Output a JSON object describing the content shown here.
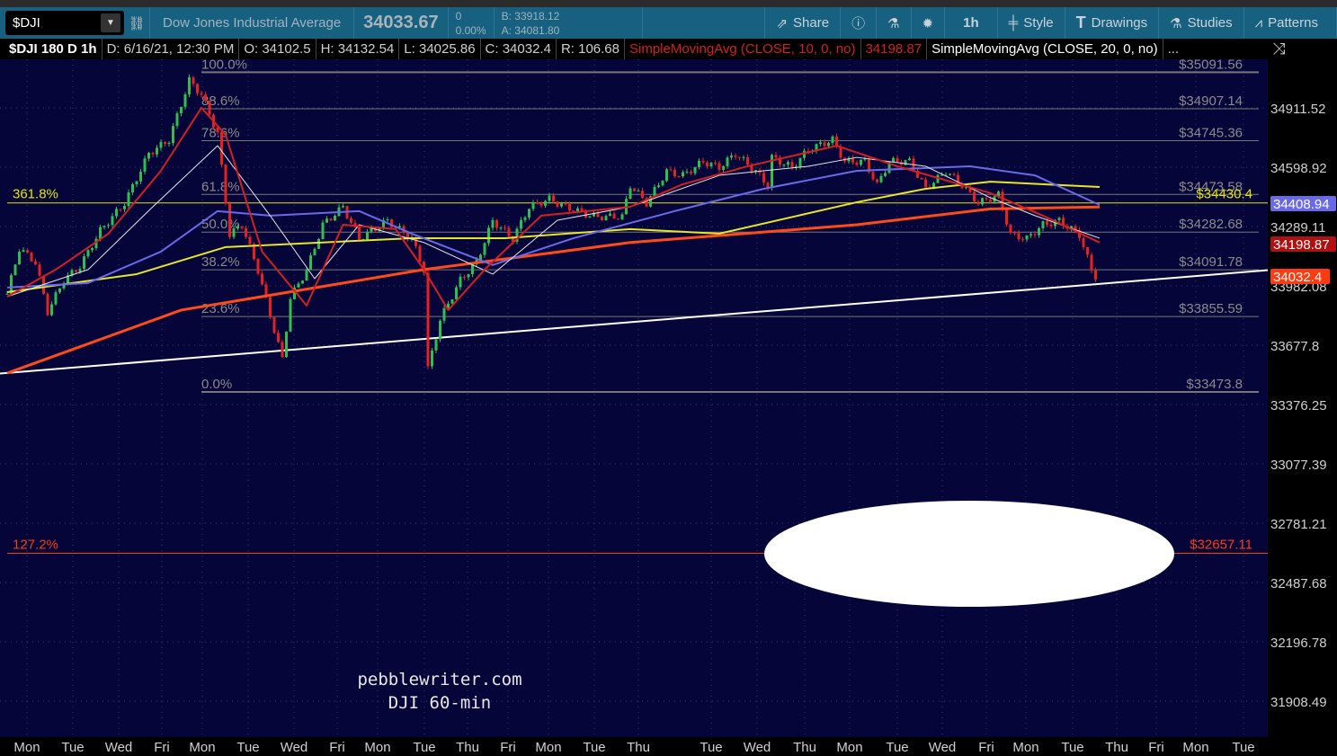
{
  "toolbar": {
    "symbol": "$DJI",
    "name": "Dow Jones Industrial Average",
    "last": "34033.67",
    "change": "0",
    "change_pct": "0.00%",
    "bid": "B: 33918.12",
    "ask": "A: 34081.80",
    "share": "Share",
    "interval": "1h",
    "style": "Style",
    "drawings": "Drawings",
    "studies": "Studies",
    "patterns": "Patterns"
  },
  "infobar": {
    "title": "$DJI 180 D 1h",
    "date": "D: 6/16/21, 12:30 PM",
    "open": "O: 34102.5",
    "high": "H: 34132.54",
    "low": "L: 34025.86",
    "close": "C: 34032.4",
    "range": "R: 106.68",
    "sma10": "SimpleMovingAvg (CLOSE, 10, 0, no)",
    "sma10_value": "34198.87",
    "sma20": "SimpleMovingAvg (CLOSE, 20, 0, no)",
    "more": "..."
  },
  "watermark": {
    "line1": "pebblewriter.com",
    "line2": "DJI  60-min"
  },
  "chart_data": {
    "type": "candlestick",
    "background": "#05053a",
    "y_ticks": [
      "34911.52",
      "34598.92",
      "34289.11",
      "33982.08",
      "33677.8",
      "33376.25",
      "33077.39",
      "32781.21",
      "32487.68",
      "32196.78",
      "31908.49"
    ],
    "x_ticks": [
      "Mon",
      "Tue",
      "Wed",
      "Fri",
      "Mon",
      "Tue",
      "Wed",
      "Fri",
      "Mon",
      "Tue",
      "Thu",
      "Fri",
      "Mon",
      "Tue",
      "Thu",
      "Tue",
      "Wed",
      "Thu",
      "Mon",
      "Tue",
      "Wed",
      "Fri",
      "Mon",
      "Tue",
      "Thu",
      "Fri",
      "Mon",
      "Tue"
    ],
    "closes": [
      [
        0,
        33970
      ],
      [
        3,
        34200
      ],
      [
        7,
        34130
      ],
      [
        10,
        33880
      ],
      [
        14,
        34040
      ],
      [
        18,
        34110
      ],
      [
        23,
        34290
      ],
      [
        29,
        34430
      ],
      [
        35,
        34680
      ],
      [
        40,
        34750
      ],
      [
        45,
        35050
      ],
      [
        48,
        34980
      ],
      [
        52,
        34780
      ],
      [
        55,
        34270
      ],
      [
        58,
        34320
      ],
      [
        62,
        34090
      ],
      [
        65,
        33860
      ],
      [
        68,
        33640
      ],
      [
        70,
        33950
      ],
      [
        74,
        34090
      ],
      [
        78,
        34320
      ],
      [
        83,
        34410
      ],
      [
        87,
        34250
      ],
      [
        94,
        34340
      ],
      [
        100,
        34250
      ],
      [
        103,
        34090
      ],
      [
        104,
        33590
      ],
      [
        107,
        33840
      ],
      [
        112,
        34040
      ],
      [
        116,
        34130
      ],
      [
        120,
        34340
      ],
      [
        125,
        34250
      ],
      [
        129,
        34410
      ],
      [
        134,
        34450
      ],
      [
        138,
        34410
      ],
      [
        145,
        34360
      ],
      [
        152,
        34360
      ],
      [
        154,
        34520
      ],
      [
        158,
        34430
      ],
      [
        163,
        34590
      ],
      [
        167,
        34570
      ],
      [
        172,
        34640
      ],
      [
        176,
        34610
      ],
      [
        180,
        34680
      ],
      [
        185,
        34590
      ],
      [
        188,
        34520
      ],
      [
        189,
        34660
      ],
      [
        194,
        34610
      ],
      [
        198,
        34700
      ],
      [
        204,
        34750
      ],
      [
        207,
        34640
      ],
      [
        212,
        34640
      ],
      [
        215,
        34520
      ],
      [
        218,
        34640
      ],
      [
        223,
        34640
      ],
      [
        227,
        34500
      ],
      [
        232,
        34590
      ],
      [
        236,
        34520
      ],
      [
        240,
        34430
      ],
      [
        245,
        34470
      ],
      [
        248,
        34270
      ],
      [
        252,
        34250
      ],
      [
        256,
        34320
      ],
      [
        260,
        34340
      ],
      [
        265,
        34270
      ],
      [
        268,
        34090
      ],
      [
        270,
        34032.4
      ]
    ],
    "series": [
      {
        "name": "SimpleMovingAvg (CLOSE, 10, 0, no)",
        "color": "#d42020",
        "points": [
          [
            0,
            33956
          ],
          [
            12,
            34093
          ],
          [
            25,
            34275
          ],
          [
            38,
            34593
          ],
          [
            48,
            34912
          ],
          [
            54,
            34775
          ],
          [
            63,
            34184
          ],
          [
            74,
            33911
          ],
          [
            83,
            34320
          ],
          [
            96,
            34298
          ],
          [
            103,
            34093
          ],
          [
            109,
            33888
          ],
          [
            118,
            34093
          ],
          [
            132,
            34366
          ],
          [
            154,
            34411
          ],
          [
            167,
            34525
          ],
          [
            183,
            34616
          ],
          [
            205,
            34720
          ],
          [
            220,
            34616
          ],
          [
            243,
            34480
          ],
          [
            256,
            34366
          ],
          [
            270,
            34230
          ]
        ]
      },
      {
        "name": "SimpleMovingAvg (CLOSE, 20, 0, no)",
        "color": "#e6e6e6",
        "points": [
          [
            0,
            33956
          ],
          [
            20,
            34093
          ],
          [
            36,
            34411
          ],
          [
            52,
            34720
          ],
          [
            65,
            34366
          ],
          [
            76,
            34047
          ],
          [
            87,
            34320
          ],
          [
            103,
            34230
          ],
          [
            120,
            34070
          ],
          [
            136,
            34343
          ],
          [
            154,
            34411
          ],
          [
            176,
            34570
          ],
          [
            198,
            34616
          ],
          [
            210,
            34661
          ],
          [
            227,
            34616
          ],
          [
            243,
            34457
          ],
          [
            254,
            34366
          ],
          [
            270,
            34252
          ]
        ]
      },
      {
        "color": "#6a6ae8",
        "points": [
          [
            0,
            34002
          ],
          [
            20,
            34025
          ],
          [
            38,
            34184
          ],
          [
            52,
            34389
          ],
          [
            65,
            34366
          ],
          [
            87,
            34389
          ],
          [
            100,
            34275
          ],
          [
            120,
            34116
          ],
          [
            140,
            34252
          ],
          [
            165,
            34389
          ],
          [
            187,
            34502
          ],
          [
            210,
            34593
          ],
          [
            238,
            34616
          ],
          [
            254,
            34570
          ],
          [
            270,
            34420
          ]
        ]
      },
      {
        "color": "#e6e62a",
        "points": [
          [
            0,
            33979
          ],
          [
            32,
            34070
          ],
          [
            54,
            34207
          ],
          [
            100,
            34252
          ],
          [
            123,
            34252
          ],
          [
            154,
            34298
          ],
          [
            176,
            34275
          ],
          [
            210,
            34434
          ],
          [
            227,
            34502
          ],
          [
            243,
            34538
          ],
          [
            270,
            34511
          ]
        ]
      },
      {
        "color": "#ff4a1a",
        "points": [
          [
            0,
            33569
          ],
          [
            43,
            33888
          ],
          [
            103,
            34093
          ],
          [
            154,
            34230
          ],
          [
            210,
            34320
          ],
          [
            243,
            34400
          ],
          [
            270,
            34410
          ]
        ]
      }
    ],
    "fib_levels": [
      {
        "pct": "100.0%",
        "price": "$35091.56",
        "value": 35091.56
      },
      {
        "pct": "88.6%",
        "price": "$34907.14",
        "value": 34907.14
      },
      {
        "pct": "78.6%",
        "price": "$34745.36",
        "value": 34745.36
      },
      {
        "pct": "61.8%",
        "price": "$34473.58",
        "value": 34473.58
      },
      {
        "pct": "50.0%",
        "price": "$34282.68",
        "value": 34282.68
      },
      {
        "pct": "38.2%",
        "price": "$34091.78",
        "value": 34091.78
      },
      {
        "pct": "23.6%",
        "price": "$33855.59",
        "value": 33855.59
      },
      {
        "pct": "0.0%",
        "price": "$33473.8",
        "value": 33473.8
      }
    ],
    "ext_levels": [
      {
        "pct": "361.8%",
        "price": "$34430.4",
        "value": 34430.4,
        "color": "#e6e600"
      },
      {
        "pct": "127.2%",
        "price": "$32657.11",
        "value": 32657.11,
        "color": "#ff3a10"
      }
    ],
    "price_tags": [
      {
        "label": "34408.94",
        "color": "#6a6ae8"
      },
      {
        "label": "34198.87",
        "color": "#b01010"
      },
      {
        "label": "34032.4",
        "color": "#ff3a10"
      }
    ],
    "trendline": {
      "start": [
        0,
        33585
      ],
      "end": [
        312,
        34090
      ],
      "color": "#ffffff"
    }
  }
}
